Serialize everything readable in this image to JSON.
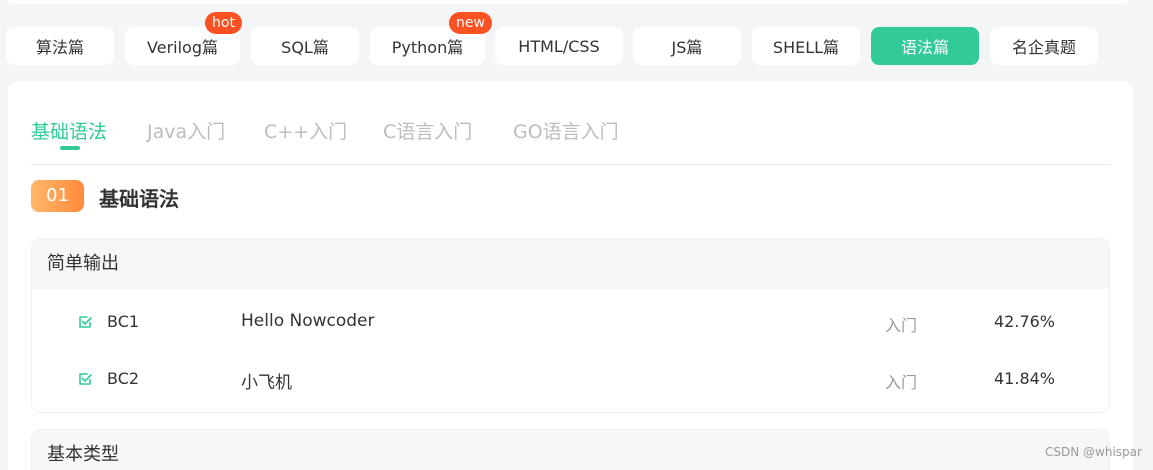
{
  "categories": [
    {
      "label": "算法篇",
      "active": false
    },
    {
      "label": "Verilog篇",
      "active": false,
      "badge": "hot"
    },
    {
      "label": "SQL篇",
      "active": false
    },
    {
      "label": "Python篇",
      "active": false,
      "badge": "new"
    },
    {
      "label": "HTML/CSS",
      "active": false
    },
    {
      "label": "JS篇",
      "active": false
    },
    {
      "label": "SHELL篇",
      "active": false
    },
    {
      "label": "语法篇",
      "active": true
    },
    {
      "label": "名企真题",
      "active": false
    }
  ],
  "tabs": [
    {
      "label": "基础语法",
      "active": true
    },
    {
      "label": "Java入门",
      "active": false
    },
    {
      "label": "C++入门",
      "active": false
    },
    {
      "label": "C语言入门",
      "active": false
    },
    {
      "label": "GO语言入门",
      "active": false
    }
  ],
  "section": {
    "number": "01",
    "title": "基础语法"
  },
  "groups": [
    {
      "title": "简单输出",
      "questions": [
        {
          "id": "BC1",
          "title": "Hello Nowcoder",
          "level": "入门",
          "pass_rate": "42.76%"
        },
        {
          "id": "BC2",
          "title": "小飞机",
          "level": "入门",
          "pass_rate": "41.84%"
        }
      ]
    },
    {
      "title": "基本类型",
      "questions": []
    }
  ],
  "watermark": "CSDN @whispar",
  "colors": {
    "accent": "#32ca99",
    "badge": "#fa5223",
    "section_badge": "#ff9a4a"
  },
  "icons": {
    "question_status": "check-square-icon"
  }
}
